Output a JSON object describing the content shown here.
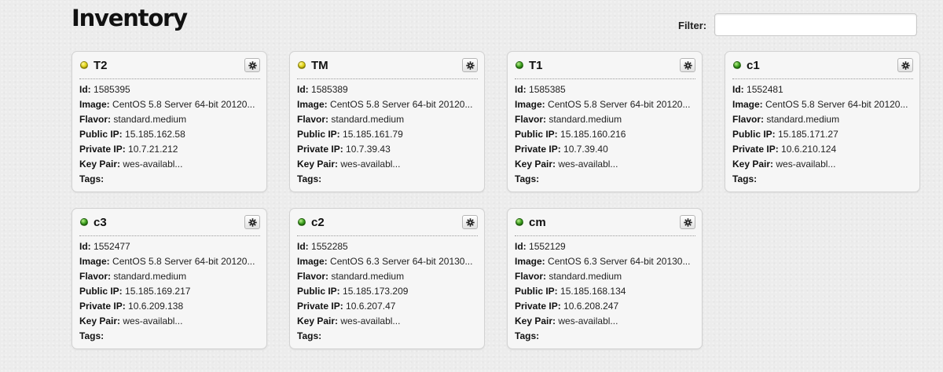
{
  "page": {
    "title": "Inventory"
  },
  "filter": {
    "label": "Filter:",
    "value": "",
    "placeholder": ""
  },
  "field_labels": {
    "id": "Id:",
    "image": "Image:",
    "flavor": "Flavor:",
    "public_ip": "Public IP:",
    "private_ip": "Private IP:",
    "key_pair": "Key Pair:",
    "tags": "Tags:"
  },
  "status_colors": {
    "yellow": "#d8cb12",
    "green": "#3a9e1d"
  },
  "cards": [
    {
      "name": "T2",
      "status": "yellow",
      "id": "1585395",
      "image": "CentOS 5.8 Server 64-bit 20120...",
      "flavor": "standard.medium",
      "public_ip": "15.185.162.58",
      "private_ip": "10.7.21.212",
      "key_pair": "wes-availabl...",
      "tags": "",
      "action_icon": "gear-icon"
    },
    {
      "name": "TM",
      "status": "yellow",
      "id": "1585389",
      "image": "CentOS 5.8 Server 64-bit 20120...",
      "flavor": "standard.medium",
      "public_ip": "15.185.161.79",
      "private_ip": "10.7.39.43",
      "key_pair": "wes-availabl...",
      "tags": "",
      "action_icon": "gear-icon"
    },
    {
      "name": "T1",
      "status": "green",
      "id": "1585385",
      "image": "CentOS 5.8 Server 64-bit 20120...",
      "flavor": "standard.medium",
      "public_ip": "15.185.160.216",
      "private_ip": "10.7.39.40",
      "key_pair": "wes-availabl...",
      "tags": "",
      "action_icon": "gear-icon"
    },
    {
      "name": "c1",
      "status": "green",
      "id": "1552481",
      "image": "CentOS 5.8 Server 64-bit 20120...",
      "flavor": "standard.medium",
      "public_ip": "15.185.171.27",
      "private_ip": "10.6.210.124",
      "key_pair": "wes-availabl...",
      "tags": "",
      "action_icon": "gear-icon"
    },
    {
      "name": "c3",
      "status": "green",
      "id": "1552477",
      "image": "CentOS 5.8 Server 64-bit 20120...",
      "flavor": "standard.medium",
      "public_ip": "15.185.169.217",
      "private_ip": "10.6.209.138",
      "key_pair": "wes-availabl...",
      "tags": "",
      "action_icon": "gear-icon"
    },
    {
      "name": "c2",
      "status": "green",
      "id": "1552285",
      "image": "CentOS 6.3 Server 64-bit 20130...",
      "flavor": "standard.medium",
      "public_ip": "15.185.173.209",
      "private_ip": "10.6.207.47",
      "key_pair": "wes-availabl...",
      "tags": "",
      "action_icon": "gear-icon"
    },
    {
      "name": "cm",
      "status": "green",
      "id": "1552129",
      "image": "CentOS 6.3 Server 64-bit 20130...",
      "flavor": "standard.medium",
      "public_ip": "15.185.168.134",
      "private_ip": "10.6.208.247",
      "key_pair": "wes-availabl...",
      "tags": "",
      "action_icon": "gear-icon"
    }
  ]
}
